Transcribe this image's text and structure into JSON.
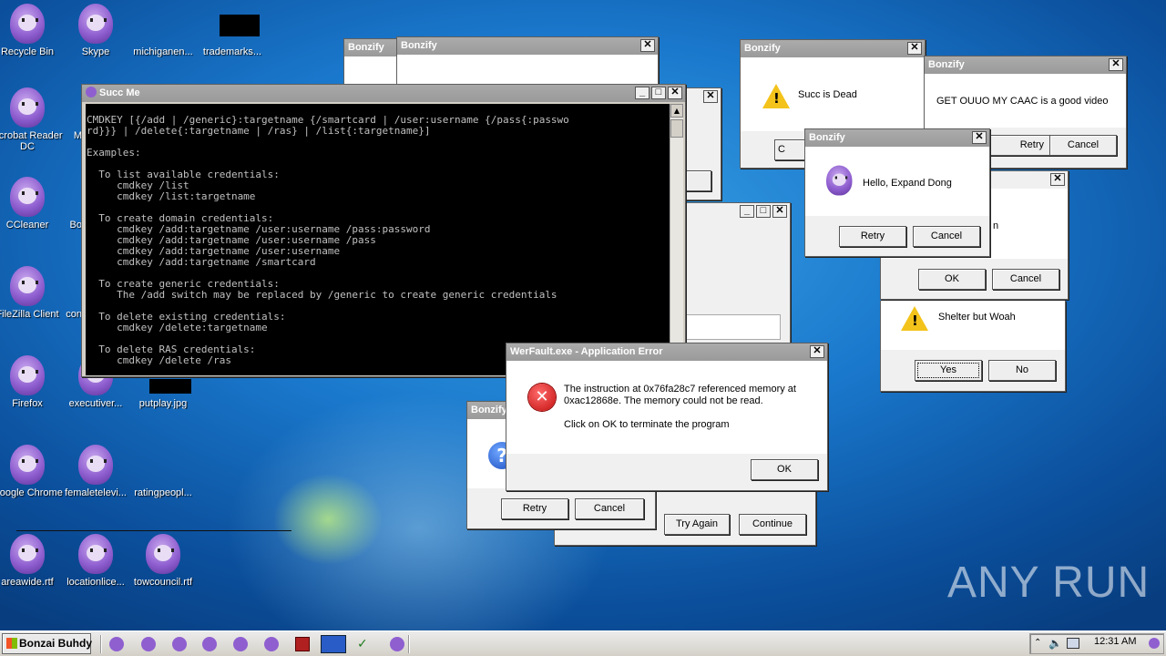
{
  "desktop": {
    "icons": [
      {
        "label": "Recycle Bin",
        "kind": "monkey"
      },
      {
        "label": "Skype",
        "kind": "monkey"
      },
      {
        "label": "michiganen...",
        "kind": "none"
      },
      {
        "label": "trademarks...",
        "kind": "black"
      },
      {
        "label": "Acrobat Reader DC",
        "kind": "monkey"
      },
      {
        "label": "Mic",
        "kind": "none"
      },
      {
        "label": "CCleaner",
        "kind": "monkey"
      },
      {
        "label": "Bo",
        "kind": "none"
      },
      {
        "label": "FileZilla Client",
        "kind": "monkey"
      },
      {
        "label": "con",
        "kind": "none"
      },
      {
        "label": "Firefox",
        "kind": "monkey"
      },
      {
        "label": "executiver...",
        "kind": "monkey"
      },
      {
        "label": "putplay.jpg",
        "kind": "black"
      },
      {
        "label": "Google Chrome",
        "kind": "monkey"
      },
      {
        "label": "femaletelevi...",
        "kind": "monkey"
      },
      {
        "label": "ratingpeopl...",
        "kind": "none"
      },
      {
        "label": "areawide.rtf",
        "kind": "monkey"
      },
      {
        "label": "locationlice...",
        "kind": "monkey"
      },
      {
        "label": "towcouncil.rtf",
        "kind": "monkey"
      }
    ],
    "watermark": "ANY RUN"
  },
  "windows": {
    "bonzify_back1": {
      "title": "Bonzify"
    },
    "bonzify_back2": {
      "title": "Bonzify",
      "close": "✕"
    },
    "succ_me": {
      "title": "Succ Me",
      "lines": [
        "CMDKEY [{/add | /generic}:targetname {/smartcard | /user:username {/pass{:passwo",
        "rd}}} | /delete{:targetname | /ras} | /list{:targetname}]",
        "",
        "Examples:",
        "",
        "  To list available credentials:",
        "     cmdkey /list",
        "     cmdkey /list:targetname",
        "",
        "  To create domain credentials:",
        "     cmdkey /add:targetname /user:username /pass:password",
        "     cmdkey /add:targetname /user:username /pass",
        "     cmdkey /add:targetname /user:username",
        "     cmdkey /add:targetname /smartcard",
        "",
        "  To create generic credentials:",
        "     The /add switch may be replaced by /generic to create generic credentials",
        "",
        "  To delete existing credentials:",
        "     cmdkey /delete:targetname",
        "",
        "  To delete RAS credentials:",
        "     cmdkey /delete /ras"
      ]
    },
    "succ_dead": {
      "title": "Bonzify",
      "message": "Succ is Dead",
      "button": "C"
    },
    "caac": {
      "title": "Bonzify",
      "message": "GET OUUO MY CAAC is a good video",
      "retry": "Retry",
      "cancel": "Cancel"
    },
    "hello": {
      "title": "Bonzify",
      "message": "Hello, Expand Dong",
      "retry": "Retry",
      "cancel": "Cancel"
    },
    "okcancel": {
      "fragment": "n",
      "ok": "OK",
      "cancel": "Cancel"
    },
    "shelter": {
      "message": "Shelter but Woah",
      "yes": "Yes",
      "no": "No"
    },
    "bonzify_bottom": {
      "title": "Bonzify",
      "retry": "Retry",
      "cancel": "Cancel"
    },
    "trycontinue": {
      "try": "Try Again",
      "cont": "Continue"
    },
    "werfault": {
      "title": "WerFault.exe - Application Error",
      "line1": "The instruction at 0x76fa28c7 referenced memory at",
      "line2": "0xac12868e. The memory could not be read.",
      "line3": "Click on OK to terminate the program",
      "ok": "OK"
    }
  },
  "taskbar": {
    "start": "Bonzai Buhdy",
    "time": "12:31 AM"
  }
}
